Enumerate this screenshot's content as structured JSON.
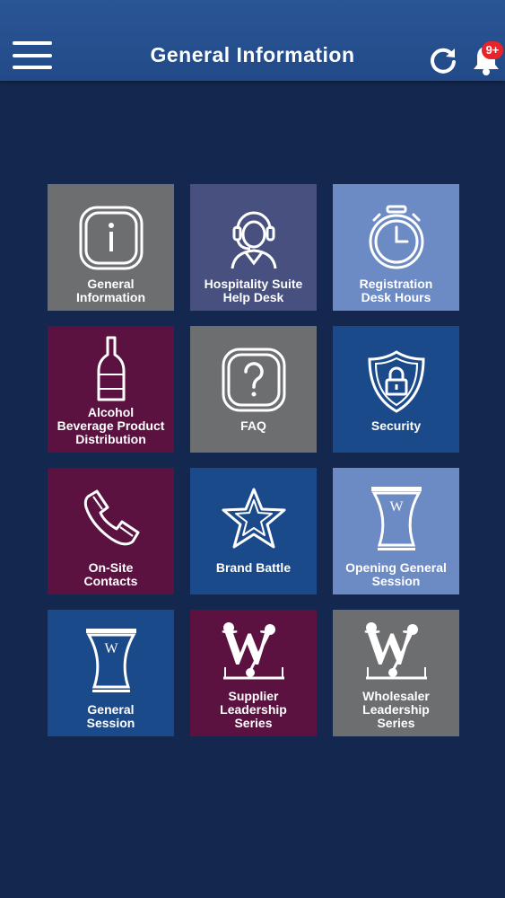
{
  "header": {
    "title": "General Information",
    "notification_badge": "9+",
    "icons": {
      "menu": "hamburger-menu-icon",
      "refresh": "refresh-icon",
      "notifications": "bell-icon"
    }
  },
  "colors": {
    "background": "#14284f",
    "header": "#2559a0",
    "tile_gray": "#6d6e70",
    "tile_purple": "#47507e",
    "tile_light_blue": "#6c8ac4",
    "tile_maroon": "#5b1240",
    "tile_blue": "#1b4a8b",
    "badge": "#e8242a"
  },
  "tiles": [
    {
      "label_lines": [
        "General",
        "Information"
      ],
      "icon": "info-icon",
      "color": "gray"
    },
    {
      "label_lines": [
        "Hospitality Suite",
        "Help Desk"
      ],
      "icon": "headset-agent-icon",
      "color": "purple"
    },
    {
      "label_lines": [
        "Registration",
        "Desk Hours"
      ],
      "icon": "alarm-clock-icon",
      "color": "light-blue"
    },
    {
      "label_lines": [
        "Alcohol",
        "Beverage Product",
        "Distribution"
      ],
      "icon": "wine-bottle-icon",
      "color": "maroon"
    },
    {
      "label_lines": [
        "FAQ"
      ],
      "icon": "question-icon",
      "color": "gray"
    },
    {
      "label_lines": [
        "Security"
      ],
      "icon": "shield-lock-icon",
      "color": "blue"
    },
    {
      "label_lines": [
        "On-Site",
        "Contacts"
      ],
      "icon": "phone-icon",
      "color": "maroon"
    },
    {
      "label_lines": [
        "Brand Battle"
      ],
      "icon": "star-icon",
      "color": "blue"
    },
    {
      "label_lines": [
        "Opening General",
        "Session"
      ],
      "icon": "vase-logo-icon",
      "color": "light-blue"
    },
    {
      "label_lines": [
        "General",
        "Session"
      ],
      "icon": "vase-logo-icon",
      "color": "blue"
    },
    {
      "label_lines": [
        "Supplier",
        "Leadership",
        "Series"
      ],
      "icon": "w-logo-icon",
      "color": "maroon"
    },
    {
      "label_lines": [
        "Wholesaler",
        "Leadership",
        "Series"
      ],
      "icon": "w-logo-icon",
      "color": "gray"
    }
  ]
}
